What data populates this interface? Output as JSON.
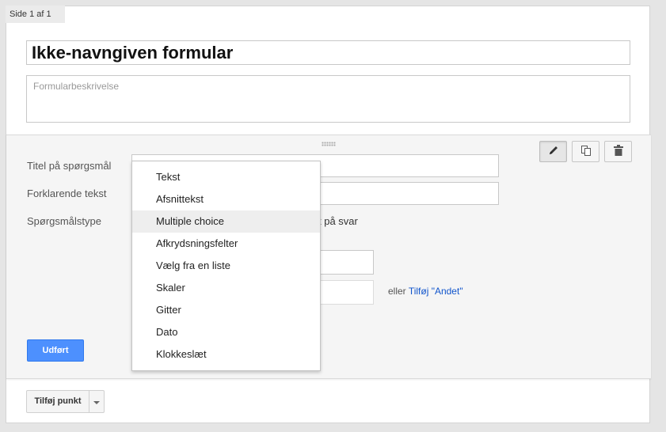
{
  "page_tab": "Side 1 af 1",
  "form": {
    "title": "Ikke-navngiven formular",
    "description_placeholder": "Formularbeskrivelse"
  },
  "question_editor": {
    "title_label": "Titel på spørgsmål",
    "help_label": "Forklarende tekst",
    "type_label": "Spørgsmålstype",
    "partial_text": "t på svar",
    "other_prefix": "eller",
    "other_link": "Tilføj \"Andet\"",
    "done_button": "Udført",
    "tools": [
      "pencil-icon",
      "copy-icon",
      "trash-icon"
    ]
  },
  "type_menu": {
    "selected": "Multiple choice",
    "items": [
      "Tekst",
      "Afsnittekst",
      "Multiple choice",
      "Afkrydsningsfelter",
      "Vælg fra en liste",
      "Skaler",
      "Gitter",
      "Dato",
      "Klokkeslæt"
    ]
  },
  "add_item": {
    "label": "Tilføj punkt"
  },
  "colors": {
    "accent": "#4d90fe",
    "link": "#1155cc"
  }
}
